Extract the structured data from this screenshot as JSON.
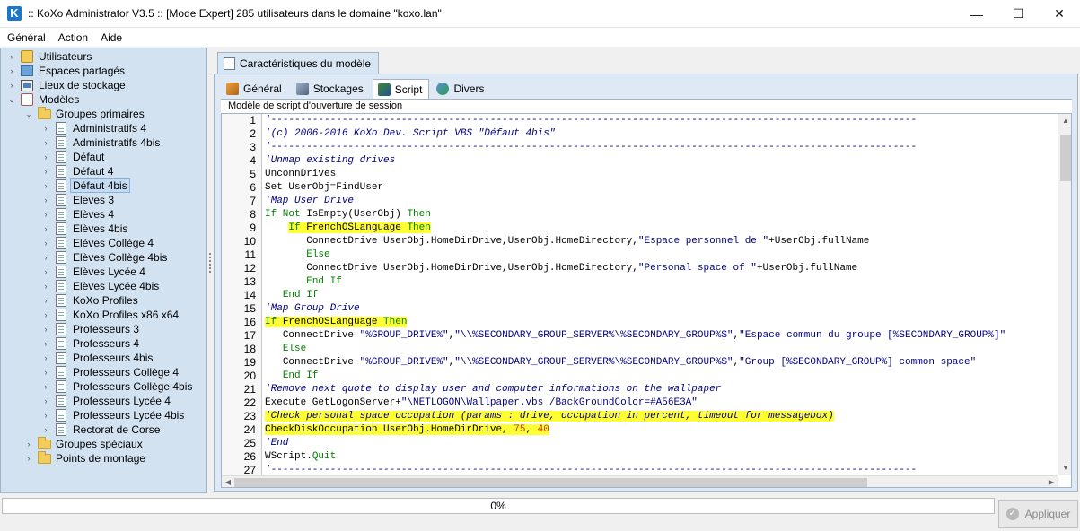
{
  "window": {
    "title": ":: KoXo Administrator V3.5 :: [Mode Expert] 285 utilisateurs dans le domaine \"koxo.lan\"",
    "minimize": "—",
    "maximize": "☐",
    "close": "✕"
  },
  "menu": [
    "Général",
    "Action",
    "Aide"
  ],
  "tree": [
    {
      "label": "Utilisateurs",
      "icon": "users-icon",
      "level": 0,
      "chevron": "›"
    },
    {
      "label": "Espaces partagés",
      "icon": "shared-space-icon",
      "level": 0,
      "chevron": "›"
    },
    {
      "label": "Lieux de stockage",
      "icon": "storage-icon",
      "level": 0,
      "chevron": "›"
    },
    {
      "label": "Modèles",
      "icon": "models-icon",
      "level": 0,
      "chevron": "⌄"
    },
    {
      "label": "Groupes primaires",
      "icon": "folder-icon",
      "level": 1,
      "chevron": "⌄"
    },
    {
      "label": "Administratifs 4",
      "icon": "document-icon",
      "level": 2,
      "chevron": "›"
    },
    {
      "label": "Administratifs 4bis",
      "icon": "document-icon",
      "level": 2,
      "chevron": "›"
    },
    {
      "label": "Défaut",
      "icon": "document-icon",
      "level": 2,
      "chevron": "›"
    },
    {
      "label": "Défaut 4",
      "icon": "document-icon",
      "level": 2,
      "chevron": "›"
    },
    {
      "label": "Défaut 4bis",
      "icon": "document-icon",
      "level": 2,
      "chevron": "›",
      "selected": true
    },
    {
      "label": "Eleves 3",
      "icon": "document-icon",
      "level": 2,
      "chevron": "›"
    },
    {
      "label": "Elèves 4",
      "icon": "document-icon",
      "level": 2,
      "chevron": "›"
    },
    {
      "label": "Elèves 4bis",
      "icon": "document-icon",
      "level": 2,
      "chevron": "›"
    },
    {
      "label": "Elèves Collège 4",
      "icon": "document-icon",
      "level": 2,
      "chevron": "›"
    },
    {
      "label": "Elèves Collège 4bis",
      "icon": "document-icon",
      "level": 2,
      "chevron": "›"
    },
    {
      "label": "Elèves Lycée 4",
      "icon": "document-icon",
      "level": 2,
      "chevron": "›"
    },
    {
      "label": "Elèves Lycée 4bis",
      "icon": "document-icon",
      "level": 2,
      "chevron": "›"
    },
    {
      "label": "KoXo Profiles",
      "icon": "document-icon",
      "level": 2,
      "chevron": "›"
    },
    {
      "label": "KoXo Profiles x86 x64",
      "icon": "document-icon",
      "level": 2,
      "chevron": "›"
    },
    {
      "label": "Professeurs 3",
      "icon": "document-icon",
      "level": 2,
      "chevron": "›"
    },
    {
      "label": "Professeurs 4",
      "icon": "document-icon",
      "level": 2,
      "chevron": "›"
    },
    {
      "label": "Professeurs 4bis",
      "icon": "document-icon",
      "level": 2,
      "chevron": "›"
    },
    {
      "label": "Professeurs Collège 4",
      "icon": "document-icon",
      "level": 2,
      "chevron": "›"
    },
    {
      "label": "Professeurs Collège 4bis",
      "icon": "document-icon",
      "level": 2,
      "chevron": "›"
    },
    {
      "label": "Professeurs Lycée 4",
      "icon": "document-icon",
      "level": 2,
      "chevron": "›"
    },
    {
      "label": "Professeurs Lycée 4bis",
      "icon": "document-icon",
      "level": 2,
      "chevron": "›"
    },
    {
      "label": "Rectorat de Corse",
      "icon": "document-icon",
      "level": 2,
      "chevron": "›"
    },
    {
      "label": "Groupes spéciaux",
      "icon": "folder-icon",
      "level": 1,
      "chevron": "›"
    },
    {
      "label": "Points de montage",
      "icon": "folder-icon",
      "level": 1,
      "chevron": "›"
    }
  ],
  "main_tab": "Caractéristiques du modèle",
  "sub_tabs": [
    {
      "label": "Général",
      "icon": "general-tab-icon",
      "cls": "general"
    },
    {
      "label": "Stockages",
      "icon": "storage-tab-icon",
      "cls": "stock"
    },
    {
      "label": "Script",
      "icon": "script-tab-icon",
      "cls": "script",
      "active": true
    },
    {
      "label": "Divers",
      "icon": "misc-tab-icon",
      "cls": "divers"
    }
  ],
  "section_label": "Modèle de script d'ouverture de session",
  "code_lines": [
    {
      "n": "1",
      "parts": [
        [
          "c-comment",
          "'-------------------------------------------------------------------------------------------------------------"
        ]
      ]
    },
    {
      "n": "2",
      "parts": [
        [
          "c-comment",
          "'(c) 2006-2016 KoXo Dev. Script VBS \"Défaut 4bis\""
        ]
      ]
    },
    {
      "n": "3",
      "parts": [
        [
          "c-comment",
          "'-------------------------------------------------------------------------------------------------------------"
        ]
      ]
    },
    {
      "n": "4",
      "parts": [
        [
          "c-comment",
          "'Unmap existing drives"
        ]
      ]
    },
    {
      "n": "5",
      "parts": [
        [
          "c-plain",
          "UnconnDrives"
        ]
      ]
    },
    {
      "n": "6",
      "parts": [
        [
          "c-plain",
          "Set UserObj=FindUser"
        ]
      ]
    },
    {
      "n": "7",
      "parts": [
        [
          "c-comment",
          "'Map User Drive"
        ]
      ]
    },
    {
      "n": "8",
      "parts": [
        [
          "c-kw",
          "If Not "
        ],
        [
          "c-plain",
          "IsEmpty(UserObj) "
        ],
        [
          "c-kw",
          "Then"
        ]
      ]
    },
    {
      "n": "9",
      "indent": "    ",
      "hl": true,
      "parts": [
        [
          "c-kw",
          "If "
        ],
        [
          "c-plain",
          "FrenchOSLanguage "
        ],
        [
          "c-kw",
          "Then"
        ]
      ]
    },
    {
      "n": "10",
      "indent": "       ",
      "parts": [
        [
          "c-plain",
          "ConnectDrive UserObj.HomeDirDrive,UserObj.HomeDirectory,"
        ],
        [
          "c-str",
          "\"Espace personnel de \""
        ],
        [
          "c-plain",
          "+UserObj.fullName"
        ]
      ]
    },
    {
      "n": "11",
      "indent": "       ",
      "parts": [
        [
          "c-kw",
          "Else"
        ]
      ]
    },
    {
      "n": "12",
      "indent": "       ",
      "parts": [
        [
          "c-plain",
          "ConnectDrive UserObj.HomeDirDrive,UserObj.HomeDirectory,"
        ],
        [
          "c-str",
          "\"Personal space of \""
        ],
        [
          "c-plain",
          "+UserObj.fullName"
        ]
      ]
    },
    {
      "n": "13",
      "indent": "       ",
      "parts": [
        [
          "c-kw",
          "End If"
        ]
      ]
    },
    {
      "n": "14",
      "indent": "   ",
      "parts": [
        [
          "c-kw",
          "End If"
        ]
      ]
    },
    {
      "n": "15",
      "parts": [
        [
          "c-comment",
          "'Map Group Drive"
        ]
      ]
    },
    {
      "n": "16",
      "hl": true,
      "parts": [
        [
          "c-kw",
          "If "
        ],
        [
          "c-plain",
          "FrenchOSLanguage "
        ],
        [
          "c-kw",
          "Then"
        ]
      ]
    },
    {
      "n": "17",
      "indent": "   ",
      "parts": [
        [
          "c-plain",
          "ConnectDrive "
        ],
        [
          "c-str",
          "\"%GROUP_DRIVE%\""
        ],
        [
          "c-plain",
          ","
        ],
        [
          "c-str",
          "\"\\\\%SECONDARY_GROUP_SERVER%\\%SECONDARY_GROUP%$\""
        ],
        [
          "c-plain",
          ","
        ],
        [
          "c-str",
          "\"Espace commun du groupe [%SECONDARY_GROUP%]\""
        ]
      ]
    },
    {
      "n": "18",
      "indent": "   ",
      "parts": [
        [
          "c-kw",
          "Else"
        ]
      ]
    },
    {
      "n": "19",
      "indent": "   ",
      "parts": [
        [
          "c-plain",
          "ConnectDrive "
        ],
        [
          "c-str",
          "\"%GROUP_DRIVE%\""
        ],
        [
          "c-plain",
          ","
        ],
        [
          "c-str",
          "\"\\\\%SECONDARY_GROUP_SERVER%\\%SECONDARY_GROUP%$\""
        ],
        [
          "c-plain",
          ","
        ],
        [
          "c-str",
          "\"Group [%SECONDARY_GROUP%] common space\""
        ]
      ]
    },
    {
      "n": "20",
      "indent": "   ",
      "parts": [
        [
          "c-kw",
          "End If"
        ]
      ]
    },
    {
      "n": "21",
      "parts": [
        [
          "c-comment",
          "'Remove next quote to display user and computer informations on the wallpaper"
        ]
      ]
    },
    {
      "n": "22",
      "parts": [
        [
          "c-plain",
          "Execute GetLogonServer+"
        ],
        [
          "c-str",
          "\"\\NETLOGON\\Wallpaper.vbs /BackGroundColor=#A56E3A\""
        ]
      ]
    },
    {
      "n": "23",
      "hl": true,
      "parts": [
        [
          "c-comment",
          "'Check personal space occupation (params : drive, occupation in percent, timeout for messagebox)"
        ]
      ]
    },
    {
      "n": "24",
      "hl": true,
      "parts": [
        [
          "c-plain",
          "CheckDiskOccupation UserObj.HomeDirDrive, "
        ],
        [
          "c-num",
          "75"
        ],
        [
          "c-plain",
          ", "
        ],
        [
          "c-num",
          "40"
        ]
      ]
    },
    {
      "n": "25",
      "parts": [
        [
          "c-comment",
          "'End"
        ]
      ]
    },
    {
      "n": "26",
      "parts": [
        [
          "c-plain",
          "WScript."
        ],
        [
          "c-kw",
          "Quit"
        ]
      ]
    },
    {
      "n": "27",
      "parts": [
        [
          "c-comment",
          "'-------------------------------------------------------------------------------------------------------------"
        ]
      ]
    }
  ],
  "progress": {
    "label": "0%",
    "value": 0
  },
  "apply_button": "Appliquer",
  "colors": {
    "accent": "#1b77c9",
    "highlight": "#ffff33",
    "tree_bg": "#d2e2f1"
  }
}
